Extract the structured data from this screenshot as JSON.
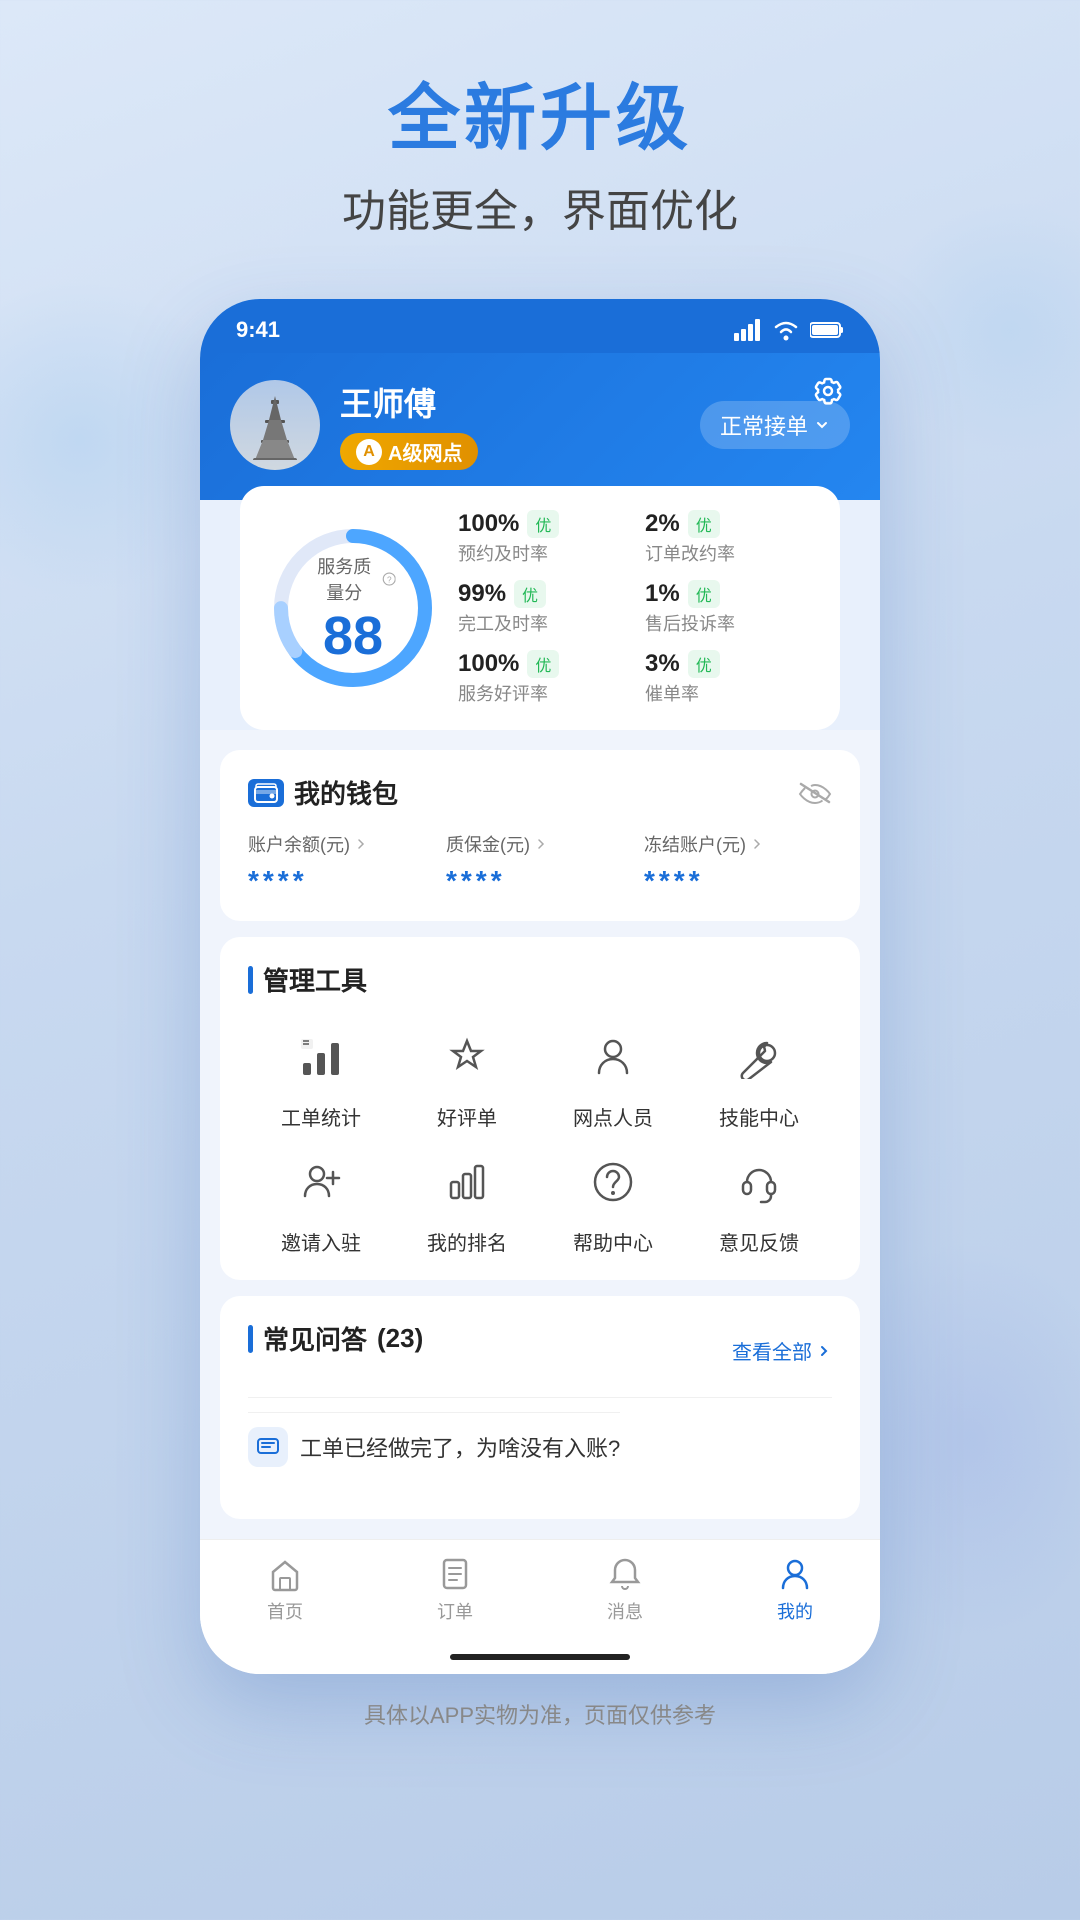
{
  "promo": {
    "title": "全新升级",
    "subtitle": "功能更全，界面优化"
  },
  "status_bar": {
    "time": "9:41"
  },
  "header": {
    "user_name": "王师傅",
    "grade": "A级网点",
    "grade_letter": "A",
    "status": "正常接单",
    "settings_label": "设置"
  },
  "score": {
    "label": "服务质量分",
    "value": "88",
    "metrics": [
      {
        "value": "100%",
        "badge": "优",
        "desc": "预约及时率"
      },
      {
        "value": "2%",
        "badge": "优",
        "desc": "订单改约率"
      },
      {
        "value": "99%",
        "badge": "优",
        "desc": "完工及时率"
      },
      {
        "value": "1%",
        "badge": "优",
        "desc": "售后投诉率"
      },
      {
        "value": "100%",
        "badge": "优",
        "desc": "服务好评率"
      },
      {
        "value": "3%",
        "badge": "优",
        "desc": "催单率"
      }
    ]
  },
  "wallet": {
    "title": "我的钱包",
    "items": [
      {
        "label": "账户余额(元)",
        "value": "****"
      },
      {
        "label": "质保金(元)",
        "value": "****"
      },
      {
        "label": "冻结账户(元)",
        "value": "****"
      }
    ]
  },
  "tools": {
    "title": "管理工具",
    "items": [
      {
        "label": "工单统计",
        "icon": "chart"
      },
      {
        "label": "好评单",
        "icon": "star"
      },
      {
        "label": "网点人员",
        "icon": "person"
      },
      {
        "label": "技能中心",
        "icon": "wrench"
      },
      {
        "label": "邀请入驻",
        "icon": "person-add"
      },
      {
        "label": "我的排名",
        "icon": "bar-chart"
      },
      {
        "label": "帮助中心",
        "icon": "help"
      },
      {
        "label": "意见反馈",
        "icon": "headset"
      }
    ]
  },
  "faq": {
    "title": "常见问答",
    "count": "(23)",
    "see_all": "查看全部",
    "items": [
      {
        "text": "工单已经做完了，为啥没有入账?"
      }
    ]
  },
  "bottom_nav": {
    "items": [
      {
        "label": "首页",
        "icon": "home",
        "active": false
      },
      {
        "label": "订单",
        "icon": "order",
        "active": false
      },
      {
        "label": "消息",
        "icon": "bell",
        "active": false
      },
      {
        "label": "我的",
        "icon": "person-fill",
        "active": true
      }
    ]
  },
  "disclaimer": "具体以APP实物为准，页面仅供参考"
}
